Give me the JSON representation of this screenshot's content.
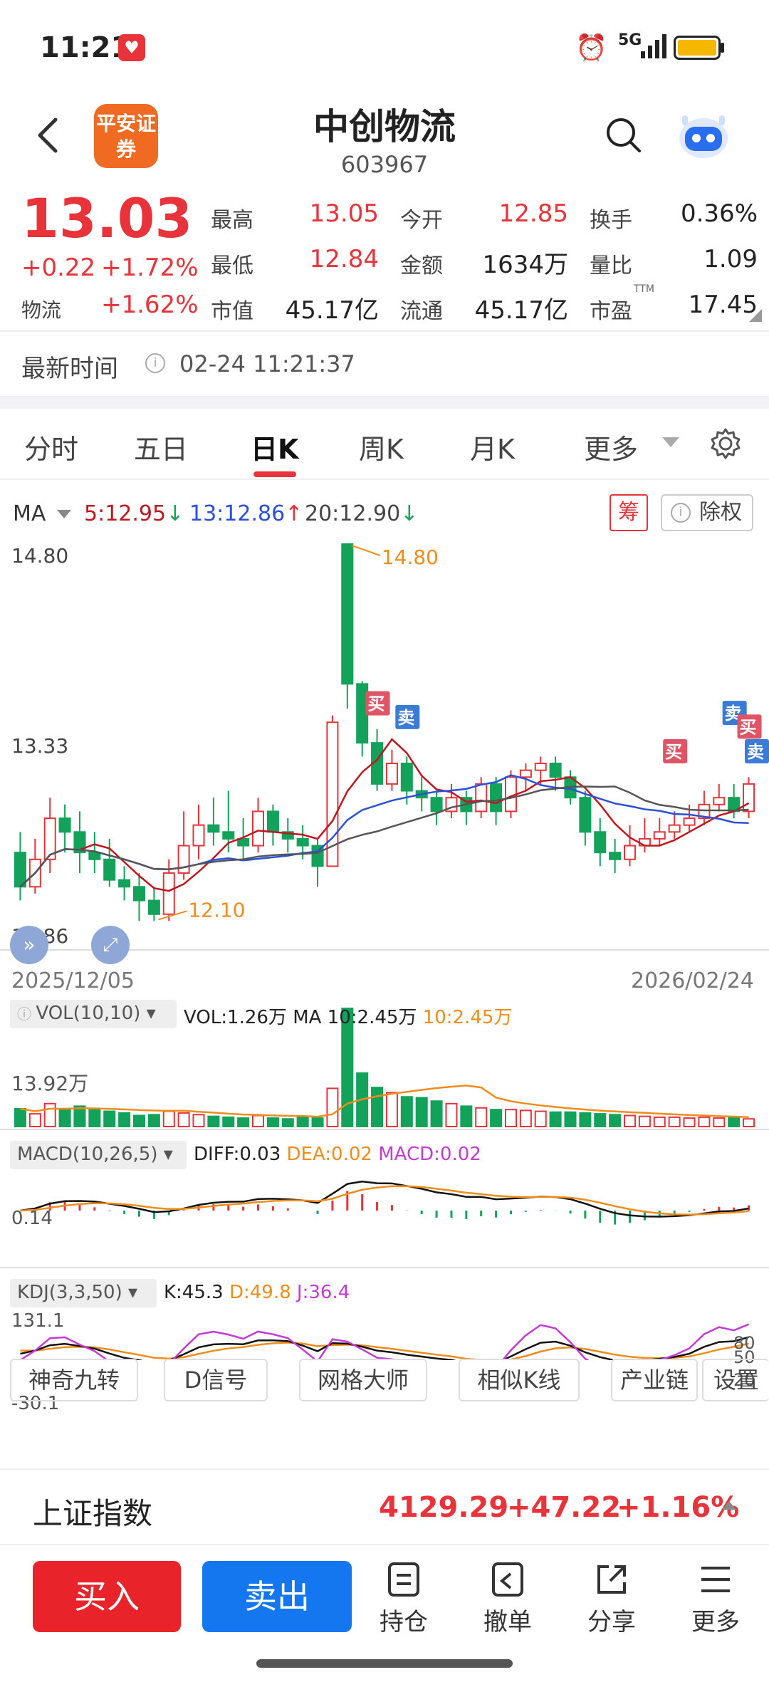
{
  "status_bar": {
    "time": "11:21",
    "network": "5G"
  },
  "header": {
    "stock_name": "中创物流",
    "stock_code": "603967",
    "broker_logo_text": "平安证券"
  },
  "quote": {
    "price": "13.03",
    "change": "+0.22",
    "change_pct": "+1.72%",
    "sector_label": "物流",
    "sector_change": "+1.62%",
    "fields": [
      {
        "label": "最高",
        "value": "13.05",
        "color": "#e8333a"
      },
      {
        "label": "今开",
        "value": "12.85",
        "color": "#e8333a"
      },
      {
        "label": "换手",
        "value": "0.36%",
        "color": "#222"
      },
      {
        "label": "最低",
        "value": "12.84",
        "color": "#e8333a"
      },
      {
        "label": "金额",
        "value": "1634万",
        "color": "#222"
      },
      {
        "label": "量比",
        "value": "1.09",
        "color": "#222"
      },
      {
        "label": "市值",
        "value": "45.17亿",
        "color": "#222"
      },
      {
        "label": "流通",
        "value": "45.17亿",
        "color": "#222"
      },
      {
        "label": "市盈",
        "value": "17.45",
        "color": "#222"
      }
    ],
    "pe_tag": "TTM",
    "time_label": "最新时间",
    "time_value": "02-24 11:21:37"
  },
  "tabs": [
    "分时",
    "五日",
    "日K",
    "周K",
    "月K",
    "更多"
  ],
  "active_tab": "日K",
  "ma_row": {
    "label": "MA",
    "items": [
      {
        "text": "5:12.95",
        "arrow": "↓",
        "color": "#c2161e",
        "arrow_color": "#16a35b"
      },
      {
        "text": "13:12.86",
        "arrow": "↑",
        "color": "#2b4fd8",
        "arrow_color": "#e8333a"
      },
      {
        "text": "20:12.90",
        "arrow": "↓",
        "color": "#444444",
        "arrow_color": "#16a35b"
      }
    ],
    "chip_label": "筹",
    "adjust_label": "除权"
  },
  "chart_data": [
    {
      "type": "candlestick",
      "y_ticks": [
        "14.80",
        "13.33",
        "11.86"
      ],
      "ylim": [
        11.86,
        14.8
      ],
      "high_marker": "14.80",
      "low_marker": "12.10",
      "signal_labels": [
        "买",
        "卖",
        "买",
        "卖",
        "买",
        "卖"
      ],
      "x_start": "2025/12/05",
      "x_end": "2026/02/24",
      "candles": [
        [
          12.55,
          12.3,
          12.7,
          12.2
        ],
        [
          12.3,
          12.5,
          12.65,
          12.25
        ],
        [
          12.5,
          12.8,
          12.95,
          12.4
        ],
        [
          12.8,
          12.7,
          12.9,
          12.55
        ],
        [
          12.7,
          12.55,
          12.85,
          12.4
        ],
        [
          12.55,
          12.5,
          12.7,
          12.4
        ],
        [
          12.5,
          12.35,
          12.65,
          12.3
        ],
        [
          12.35,
          12.3,
          12.45,
          12.2
        ],
        [
          12.3,
          12.2,
          12.4,
          12.05
        ],
        [
          12.2,
          12.1,
          12.3,
          12.05
        ],
        [
          12.1,
          12.4,
          12.5,
          12.05
        ],
        [
          12.4,
          12.6,
          12.85,
          12.35
        ],
        [
          12.6,
          12.75,
          12.9,
          12.5
        ],
        [
          12.75,
          12.7,
          12.95,
          12.6
        ],
        [
          12.7,
          12.65,
          13.0,
          12.55
        ],
        [
          12.65,
          12.6,
          12.8,
          12.5
        ],
        [
          12.6,
          12.85,
          12.95,
          12.55
        ],
        [
          12.85,
          12.7,
          12.9,
          12.6
        ],
        [
          12.7,
          12.65,
          12.8,
          12.55
        ],
        [
          12.65,
          12.6,
          12.75,
          12.5
        ],
        [
          12.6,
          12.45,
          12.65,
          12.3
        ],
        [
          12.45,
          13.5,
          13.55,
          12.45
        ],
        [
          14.8,
          13.78,
          14.8,
          13.6
        ],
        [
          13.78,
          13.35,
          13.8,
          13.25
        ],
        [
          13.35,
          13.05,
          13.45,
          13.0
        ],
        [
          13.05,
          13.2,
          13.3,
          13.0
        ],
        [
          13.2,
          13.0,
          13.25,
          12.9
        ],
        [
          13.0,
          12.95,
          13.1,
          12.85
        ],
        [
          12.95,
          12.85,
          13.0,
          12.75
        ],
        [
          12.85,
          12.95,
          13.05,
          12.8
        ],
        [
          12.95,
          12.85,
          13.0,
          12.75
        ],
        [
          12.85,
          13.05,
          13.1,
          12.8
        ],
        [
          13.05,
          12.85,
          13.1,
          12.75
        ],
        [
          12.85,
          13.1,
          13.15,
          12.8
        ],
        [
          13.1,
          13.15,
          13.2,
          13.0
        ],
        [
          13.15,
          13.2,
          13.25,
          13.05
        ],
        [
          13.2,
          13.1,
          13.25,
          13.0
        ],
        [
          13.1,
          12.95,
          13.15,
          12.9
        ],
        [
          12.95,
          12.7,
          13.0,
          12.6
        ],
        [
          12.7,
          12.55,
          12.8,
          12.45
        ],
        [
          12.55,
          12.5,
          12.65,
          12.4
        ],
        [
          12.5,
          12.6,
          12.75,
          12.45
        ],
        [
          12.6,
          12.65,
          12.8,
          12.55
        ],
        [
          12.65,
          12.7,
          12.8,
          12.6
        ],
        [
          12.7,
          12.75,
          12.85,
          12.65
        ],
        [
          12.75,
          12.8,
          12.9,
          12.7
        ],
        [
          12.8,
          12.9,
          13.0,
          12.75
        ],
        [
          12.9,
          12.95,
          13.05,
          12.85
        ],
        [
          12.95,
          12.85,
          13.05,
          12.8
        ],
        [
          12.85,
          13.05,
          13.1,
          12.8
        ]
      ],
      "ma5_color": "#c2161e",
      "ma13_color": "#2b4fd8",
      "ma20_color": "#555555"
    },
    {
      "type": "bar",
      "name": "VOL",
      "header": "VOL(10,10)",
      "values_text": "VOL:1.26万",
      "ma_text": "MA 10:2.45万",
      "ma2_text": "10:2.45万",
      "y_tick": "13.92万",
      "volumes": [
        2.1,
        1.5,
        2.7,
        2.1,
        2.4,
        2.0,
        1.8,
        1.6,
        1.3,
        1.4,
        1.8,
        1.6,
        1.4,
        1.2,
        1.1,
        1.0,
        1.3,
        1.0,
        0.9,
        1.1,
        1.0,
        4.5,
        13.92,
        6.3,
        4.6,
        4.0,
        3.5,
        3.4,
        3.0,
        2.7,
        2.4,
        2.2,
        2.0,
        2.0,
        1.9,
        1.8,
        1.7,
        1.7,
        1.6,
        1.5,
        1.4,
        1.3,
        1.2,
        1.1,
        1.1,
        1.0,
        1.1,
        1.0,
        1.0,
        0.9
      ]
    },
    {
      "type": "line",
      "name": "MACD",
      "header": "MACD(10,26,5)",
      "diff_text": "DIFF:0.03",
      "dea_text": "DEA:0.02",
      "macd_text": "MACD:0.02",
      "y_tick": "0.14"
    },
    {
      "type": "line",
      "name": "KDJ",
      "header": "KDJ(3,3,50)",
      "k_text": "K:45.3",
      "d_text": "D:49.8",
      "j_text": "J:36.4",
      "y_top": "131.1",
      "y_bottom": "-30.1",
      "right_ticks": [
        "80",
        "50",
        "20"
      ]
    }
  ],
  "toolbar": [
    "神奇九转",
    "D信号",
    "网格大师",
    "相似K线",
    "产业链",
    "设置"
  ],
  "index": {
    "name": "上证指数",
    "value": "4129.29",
    "change": "+47.22",
    "pct": "+1.16%"
  },
  "actions": {
    "buy": "买入",
    "sell": "卖出",
    "items": [
      "持仓",
      "撤单",
      "分享",
      "更多"
    ]
  }
}
